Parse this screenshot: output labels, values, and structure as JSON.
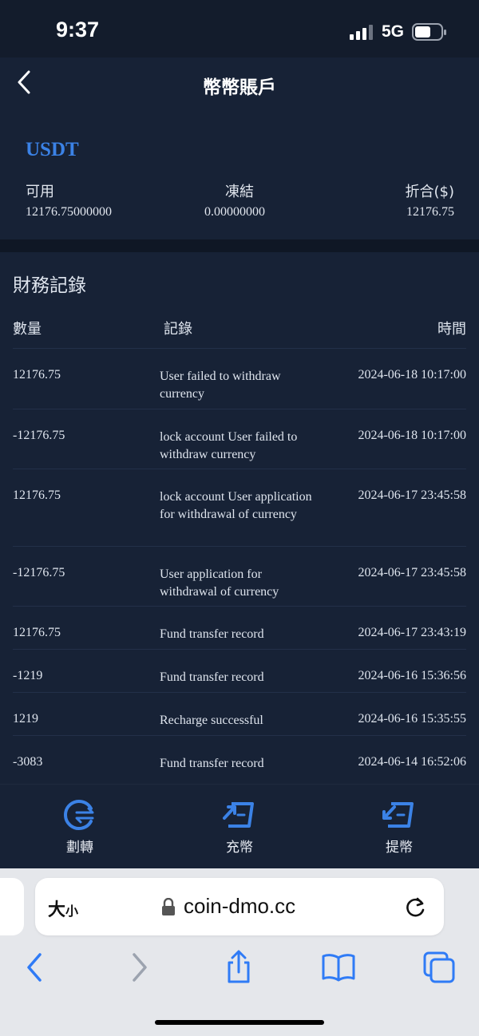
{
  "status_bar": {
    "time": "9:37",
    "network": "5G"
  },
  "header": {
    "title": "幣幣賬戶"
  },
  "account": {
    "coin": "USDT",
    "available_label": "可用",
    "available_value": "12176.75000000",
    "frozen_label": "凍結",
    "frozen_value": "0.00000000",
    "converted_label": "折合($)",
    "converted_value": "12176.75"
  },
  "records": {
    "title": "財務記錄",
    "columns": {
      "amount": "數量",
      "record": "記錄",
      "time": "時間"
    },
    "rows": [
      {
        "amount": "12176.75",
        "record": "User failed to withdraw currency",
        "time": "2024-06-18 10:17:00"
      },
      {
        "amount": "-12176.75",
        "record": "lock account User failed to withdraw currency",
        "time": "2024-06-18 10:17:00"
      },
      {
        "amount": "12176.75",
        "record": "lock account User application for withdrawal of currency",
        "time": "2024-06-17 23:45:58"
      },
      {
        "amount": "-12176.75",
        "record": "User application for withdrawal of currency",
        "time": "2024-06-17 23:45:58"
      },
      {
        "amount": "12176.75",
        "record": "Fund transfer record",
        "time": "2024-06-17 23:43:19"
      },
      {
        "amount": "-1219",
        "record": "Fund transfer record",
        "time": "2024-06-16 15:36:56"
      },
      {
        "amount": "1219",
        "record": "Recharge successful",
        "time": "2024-06-16 15:35:55"
      },
      {
        "amount": "-3083",
        "record": "Fund transfer record",
        "time": "2024-06-14 16:52:06"
      }
    ]
  },
  "bottom_nav": {
    "transfer": {
      "label": "劃轉",
      "icon": "transfer-icon"
    },
    "deposit": {
      "label": "充幣",
      "icon": "deposit-icon"
    },
    "withdraw": {
      "label": "提幣",
      "icon": "withdraw-icon"
    }
  },
  "browser": {
    "text_size_big": "大",
    "text_size_small": "小",
    "domain": "coin-dmo.cc"
  },
  "colors": {
    "accent": "#3b82e6",
    "background": "#172236",
    "browser_blue": "#2f7bf6"
  }
}
